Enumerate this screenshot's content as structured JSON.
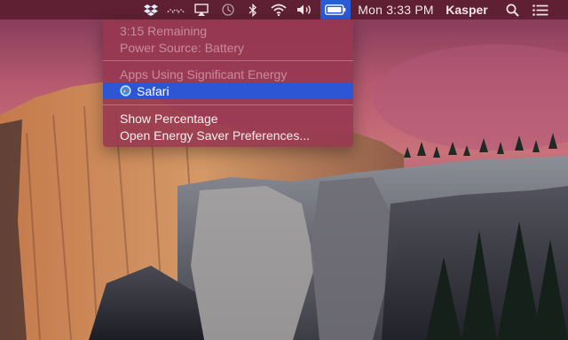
{
  "menubar": {
    "clock": "Mon 3:33 PM",
    "user": "Kasper",
    "icons": [
      "dropbox-icon",
      "wifi-share-icon",
      "airplay-icon",
      "time-machine-icon",
      "bluetooth-icon",
      "wifi-icon",
      "volume-icon",
      "battery-icon",
      "spotlight-icon",
      "notification-center-icon"
    ]
  },
  "battery_menu": {
    "time_remaining": "3:15 Remaining",
    "power_source": "Power Source: Battery",
    "apps_header": "Apps Using Significant Energy",
    "apps": [
      {
        "name": "Safari"
      }
    ],
    "show_percentage": "Show Percentage",
    "open_prefs": "Open Energy Saver Preferences..."
  },
  "colors": {
    "menubar_bg": "#5c1e30",
    "highlight": "#2c56d3",
    "menu_bg": "#96374f"
  }
}
